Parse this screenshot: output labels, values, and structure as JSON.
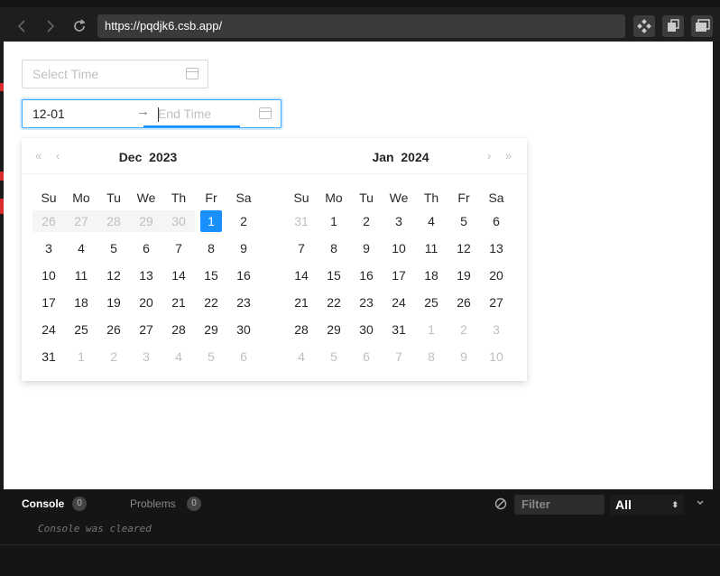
{
  "browser": {
    "url": "https://pqdjk6.csb.app/",
    "back_icon": "chevron-left-icon",
    "forward_icon": "chevron-right-icon",
    "reload_icon": "reload-icon"
  },
  "page": {
    "single_picker": {
      "placeholder": "Select Time"
    },
    "range_picker": {
      "start_value": "12-01",
      "separator": "→",
      "end_placeholder": "End Time"
    }
  },
  "calendar": {
    "prev_year": "«",
    "prev_month": "‹",
    "next_month": "›",
    "next_year": "»",
    "weekdays": [
      "Su",
      "Mo",
      "Tu",
      "We",
      "Th",
      "Fr",
      "Sa"
    ],
    "left": {
      "month": "Dec",
      "year": "2023",
      "weeks": [
        [
          "26",
          "27",
          "28",
          "29",
          "30",
          "1",
          "2"
        ],
        [
          "3",
          "4",
          "5",
          "6",
          "7",
          "8",
          "9"
        ],
        [
          "10",
          "11",
          "12",
          "13",
          "14",
          "15",
          "16"
        ],
        [
          "17",
          "18",
          "19",
          "20",
          "21",
          "22",
          "23"
        ],
        [
          "24",
          "25",
          "26",
          "27",
          "28",
          "29",
          "30"
        ],
        [
          "31",
          "1",
          "2",
          "3",
          "4",
          "5",
          "6"
        ]
      ]
    },
    "right": {
      "month": "Jan",
      "year": "2024",
      "weeks": [
        [
          "31",
          "1",
          "2",
          "3",
          "4",
          "5",
          "6"
        ],
        [
          "7",
          "8",
          "9",
          "10",
          "11",
          "12",
          "13"
        ],
        [
          "14",
          "15",
          "16",
          "17",
          "18",
          "19",
          "20"
        ],
        [
          "21",
          "22",
          "23",
          "24",
          "25",
          "26",
          "27"
        ],
        [
          "28",
          "29",
          "30",
          "31",
          "1",
          "2",
          "3"
        ],
        [
          "4",
          "5",
          "6",
          "7",
          "8",
          "9",
          "10"
        ]
      ]
    },
    "selected_date": "1"
  },
  "console": {
    "tab_console": "Console",
    "console_count": "0",
    "tab_problems": "Problems",
    "problems_count": "0",
    "filter_placeholder": "Filter",
    "level": "All",
    "message": "Console was cleared"
  }
}
